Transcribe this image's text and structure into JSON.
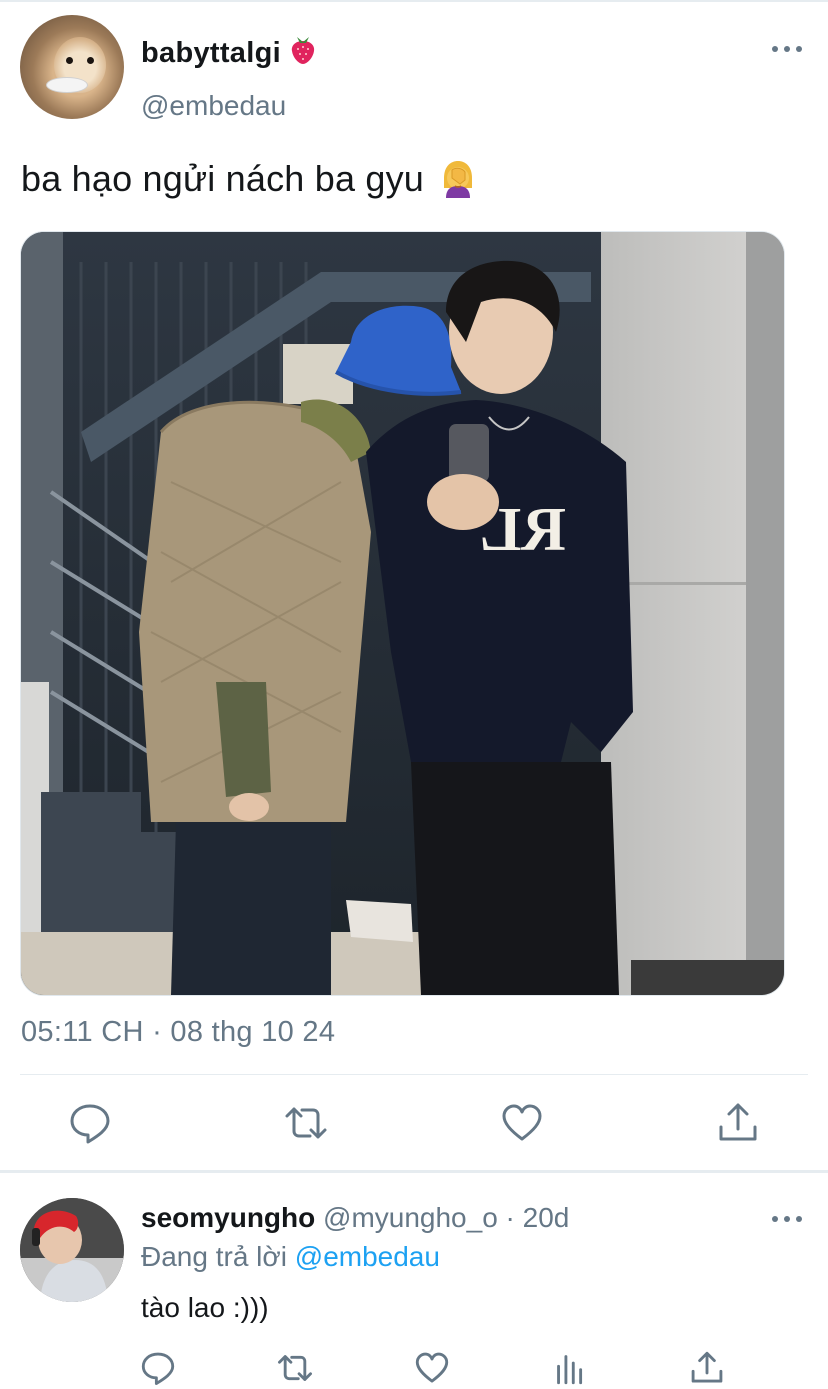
{
  "tweet": {
    "display_name": "babyttalgi",
    "name_emoji": "strawberry-emoji",
    "handle": "@embedau",
    "text": "ba hạo ngửi nách ba gyu",
    "text_emoji": "woman-facepalming-emoji",
    "timestamp": "05:11 CH · 08 thg 10 24",
    "photo_text": "RL",
    "actions": [
      "reply-icon",
      "retweet-icon",
      "like-icon",
      "share-icon"
    ]
  },
  "reply": {
    "display_name": "seomyungho",
    "handle_time": "@myungho_o · 20d",
    "replying_prefix": "Đang trả lời",
    "replying_mention": "@embedau",
    "text": "tào lao :)))",
    "actions": [
      "reply-icon",
      "retweet-icon",
      "like-icon",
      "analytics-icon",
      "share-icon"
    ]
  },
  "colors": {
    "text_primary": "#14171a",
    "text_secondary": "#657786",
    "link": "#1da1f2",
    "divider": "#e6ecf0"
  }
}
